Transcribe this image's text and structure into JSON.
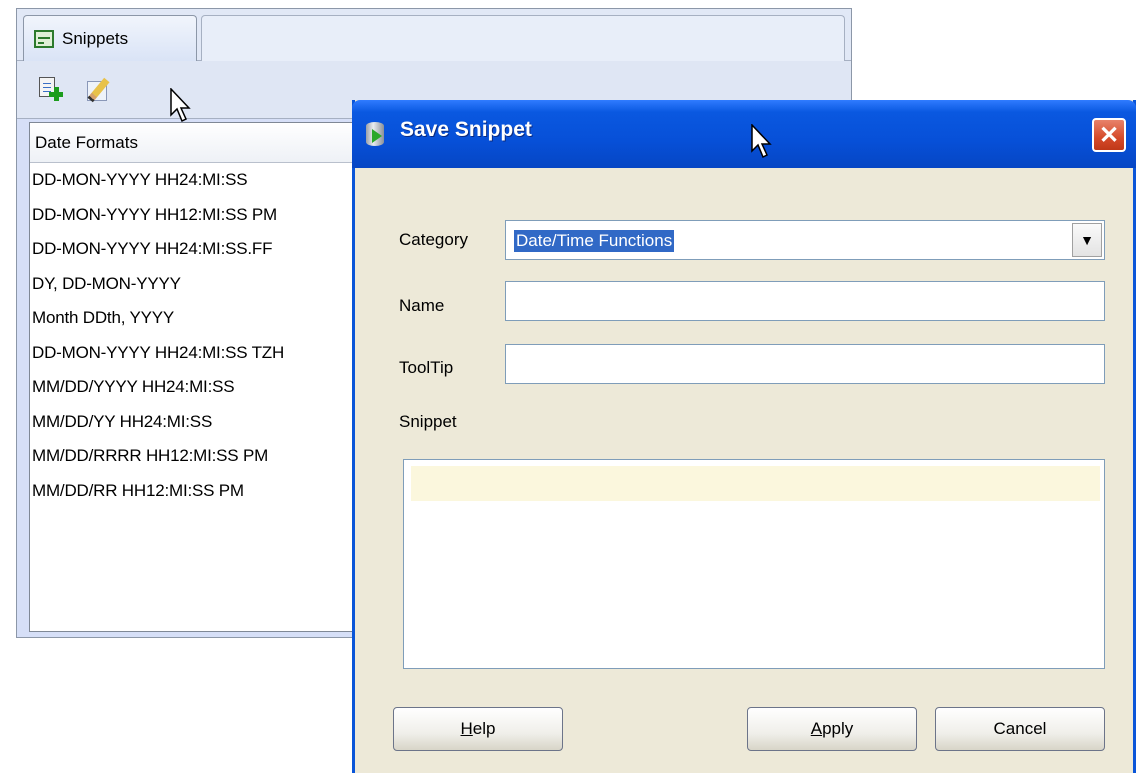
{
  "panel": {
    "tab_label": "Snippets",
    "category_header": "Date Formats",
    "items": [
      "DD-MON-YYYY HH24:MI:SS",
      "DD-MON-YYYY HH12:MI:SS PM",
      "DD-MON-YYYY HH24:MI:SS.FF",
      "DY, DD-MON-YYYY",
      "Month DDth, YYYY",
      "DD-MON-YYYY HH24:MI:SS TZH",
      "MM/DD/YYYY HH24:MI:SS",
      "MM/DD/YY HH24:MI:SS",
      "MM/DD/RRRR HH12:MI:SS PM",
      "MM/DD/RR HH12:MI:SS PM"
    ],
    "toolbar_icons": [
      "add-snippet-icon",
      "edit-snippet-icon"
    ]
  },
  "dialog": {
    "title": "Save Snippet",
    "close_glyph": "✕",
    "category_label": "Category",
    "category_value": "Date/Time Functions",
    "name_label": "Name",
    "name_value": "",
    "tooltip_label": "ToolTip",
    "tooltip_value": "",
    "snippet_label": "Snippet",
    "snippet_value": "",
    "help_label": "Help",
    "apply_label": "Apply",
    "cancel_label": "Cancel"
  },
  "colors": {
    "titlebar": "#0750d8",
    "dialog_bg": "#ede9d8",
    "selection": "#3169c6",
    "close_button": "#d54a2a"
  }
}
